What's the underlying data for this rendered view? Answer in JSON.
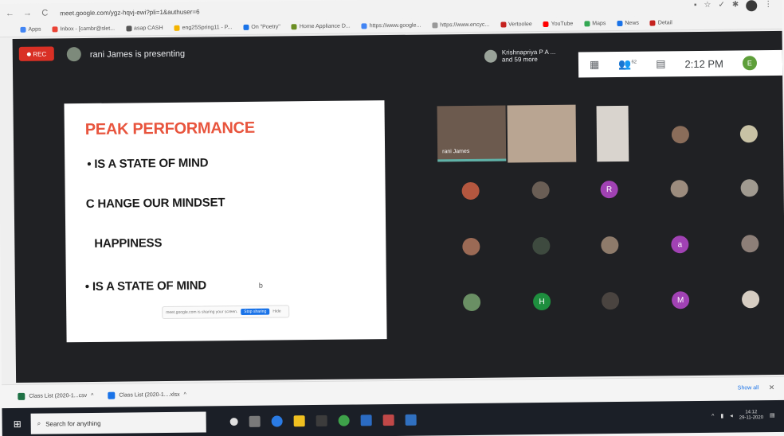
{
  "browser": {
    "url": "meet.google.com/ygz-hqvj-ewi?pli=1&authuser=6",
    "bookmarks": [
      "Apps",
      "Inbox - [cambr@slet...",
      "asap CASH",
      "eng25Spring11 - P...",
      "On \"Poetry\"",
      "Home Appliance D...",
      "https://www.google...",
      "https://www.encyc...",
      "Vertoolee",
      "YouTube",
      "Maps",
      "News",
      "Detail"
    ]
  },
  "meet": {
    "rec_label": "REC",
    "presenting_text": "rani James is presenting",
    "participants_chip": [
      "Krishnapriya P A ...",
      "and 59 more"
    ],
    "time": "2:12 PM",
    "you_initial": "E",
    "participant_count": "62"
  },
  "slide": {
    "title": "PEAK PERFORMANCE",
    "line1": "• IS A STATE OF MIND",
    "line2": "C HANGE OUR MINDSET",
    "line3": "HAPPINESS",
    "line4": "• IS A STATE OF MIND",
    "cursor": "b",
    "share_bar_text": "meet.google.com is sharing your screen.",
    "stop_label": "Stop sharing",
    "hide_label": "Hide"
  },
  "tiles": {
    "main_name": "rani James",
    "initials": [
      "R",
      "a",
      "H",
      "M"
    ]
  },
  "downloads": {
    "items": [
      "Class List (2020-1...csv",
      "Class List (2020-1....xlsx"
    ],
    "show_all": "Show all",
    "close": "✕"
  },
  "taskbar": {
    "search_placeholder": "Search for anything",
    "clock_time": "14:12",
    "clock_date": "29-11-2020"
  }
}
